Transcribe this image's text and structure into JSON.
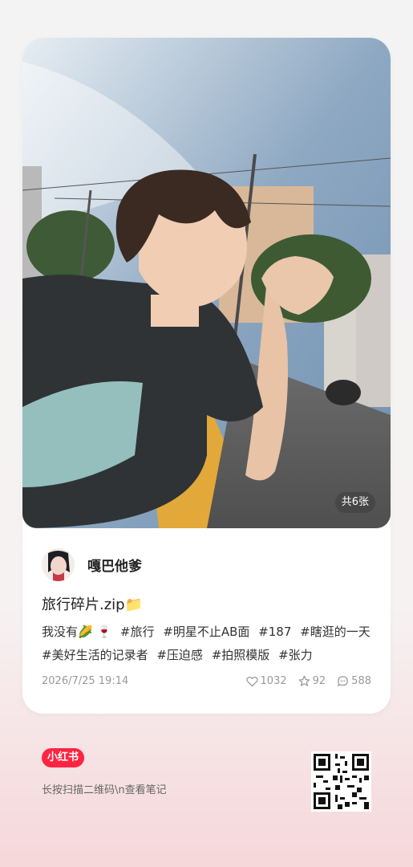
{
  "post": {
    "image_count": "共6张",
    "author_name": "嘎巴他爹",
    "title": "旅行碎片.zip📁",
    "description_parts": [
      "我没有🌽 🍷",
      "#旅行",
      "#明星不止AB面",
      "#187",
      "#瞎逛的一天",
      "#美好生活的记录者",
      "#压迫感",
      "#拍照模版",
      "#张力"
    ],
    "date": "2026/7/25 19:14",
    "likes": "1032",
    "favorites": "92",
    "comments": "588"
  },
  "footer": {
    "brand": "小红书",
    "scan_tip": "长按扫描二维码\\n查看笔记"
  },
  "colors": {
    "brand": "#ff2442",
    "muted": "#999999"
  },
  "icons": [
    "heart-icon",
    "star-icon",
    "comment-icon",
    "qr-code"
  ]
}
